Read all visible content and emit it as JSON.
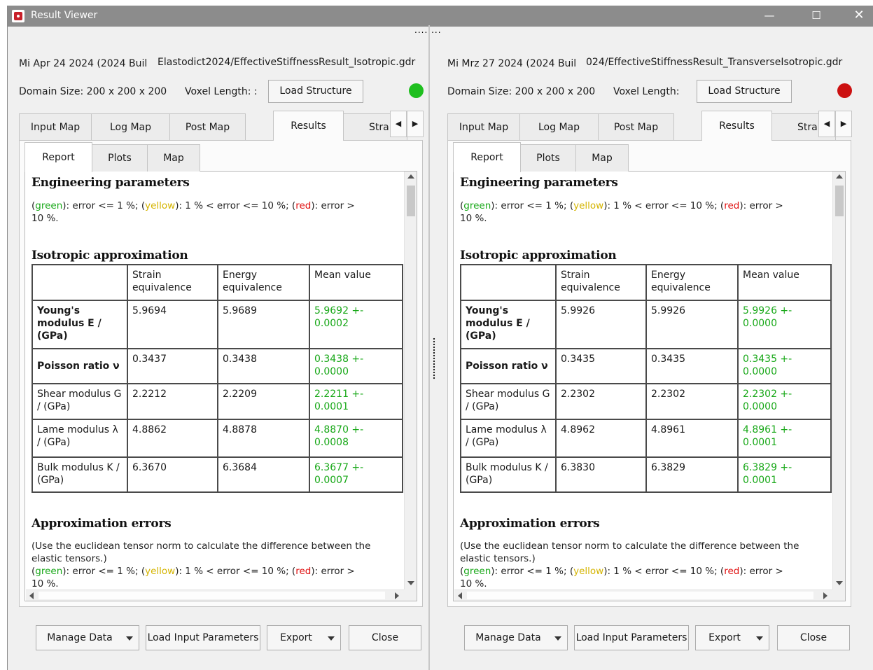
{
  "window": {
    "title": "Result Viewer",
    "min_glyph": "—",
    "max_glyph": "☐",
    "close_glyph": "✕",
    "splitter_dots": "........"
  },
  "panels": [
    {
      "date": "Mi Apr 24 2024 (2024 Buil",
      "path": "Elastodict2024/EffectiveStiffnessResult_Isotropic.gdr",
      "domain_size": "Domain Size: 200 x 200 x 200",
      "voxel_length": "Voxel Length: :",
      "load_structure": "Load Structure",
      "status_color": "#1fbf1f",
      "tabs": [
        "Input Map",
        "Log Map",
        "Post Map",
        "Results",
        "Stra"
      ],
      "subtabs": [
        "Report",
        "Plots",
        "Map"
      ],
      "report": {
        "heading1": "Engineering parameters",
        "legend": {
          "p1": "(",
          "green": "green",
          "p2": "): error <= 1 %; (",
          "yellow": "yellow",
          "p3": "): 1 % < error <= 10 %; (",
          "red": "red",
          "p4": "): error >",
          "p5": "10 %."
        },
        "heading2": "Isotropic approximation",
        "columns": [
          "",
          "Strain equivalence",
          "Energy equivalence",
          "Mean value"
        ],
        "rows": [
          {
            "label": "Young's modulus E / (GPa)",
            "bold": true,
            "strain": "5.9694",
            "energy": "5.9689",
            "mean": "5.9692 +- 0.0002"
          },
          {
            "label": "Poisson ratio ν",
            "bold": true,
            "strain": "0.3437",
            "energy": "0.3438",
            "mean": "0.3438 +- 0.0000"
          },
          {
            "label": "Shear modulus G / (GPa)",
            "bold": false,
            "strain": "2.2212",
            "energy": "2.2209",
            "mean": "2.2211 +- 0.0001"
          },
          {
            "label": "Lame modulus λ / (GPa)",
            "bold": false,
            "strain": "4.8862",
            "energy": "4.8878",
            "mean": "4.8870 +- 0.0008"
          },
          {
            "label": "Bulk modulus K / (GPa)",
            "bold": false,
            "strain": "6.3670",
            "energy": "6.3684",
            "mean": "6.3677 +- 0.0007"
          }
        ],
        "heading3": "Approximation errors",
        "errors_text": "(Use the euclidean tensor norm to calculate the difference between the elastic tensors.)",
        "legend2_tail": "10 %."
      },
      "buttons": {
        "manage": "Manage Data",
        "load_params": "Load Input Parameters",
        "export": "Export",
        "close": "Close"
      }
    },
    {
      "date": "Mi Mrz 27 2024 (2024 Buil",
      "path": "024/EffectiveStiffnessResult_TransverseIsotropic.gdr",
      "domain_size": "Domain Size: 200 x 200 x 200",
      "voxel_length": "Voxel Length:",
      "load_structure": "Load Structure",
      "status_color": "#cc1111",
      "tabs": [
        "Input Map",
        "Log Map",
        "Post Map",
        "Results",
        "Stra"
      ],
      "subtabs": [
        "Report",
        "Plots",
        "Map"
      ],
      "report": {
        "heading1": "Engineering parameters",
        "legend": {
          "p1": "(",
          "green": "green",
          "p2": "): error <= 1 %; (",
          "yellow": "yellow",
          "p3": "): 1 % < error <= 10 %; (",
          "red": "red",
          "p4": "): error >",
          "p5": "10 %."
        },
        "heading2": "Isotropic approximation",
        "columns": [
          "",
          "Strain equivalence",
          "Energy equivalence",
          "Mean value"
        ],
        "rows": [
          {
            "label": "Young's modulus E / (GPa)",
            "bold": true,
            "strain": "5.9926",
            "energy": "5.9926",
            "mean": "5.9926 +- 0.0000"
          },
          {
            "label": "Poisson ratio ν",
            "bold": true,
            "strain": "0.3435",
            "energy": "0.3435",
            "mean": "0.3435 +- 0.0000"
          },
          {
            "label": "Shear modulus G / (GPa)",
            "bold": false,
            "strain": "2.2302",
            "energy": "2.2302",
            "mean": "2.2302 +- 0.0000"
          },
          {
            "label": "Lame modulus λ / (GPa)",
            "bold": false,
            "strain": "4.8962",
            "energy": "4.8961",
            "mean": "4.8961 +- 0.0001"
          },
          {
            "label": "Bulk modulus K / (GPa)",
            "bold": false,
            "strain": "6.3830",
            "energy": "6.3829",
            "mean": "6.3829 +- 0.0001"
          }
        ],
        "heading3": "Approximation errors",
        "errors_text": "(Use the euclidean tensor norm to calculate the difference between the elastic tensors.)",
        "legend2_tail": "10 %."
      },
      "buttons": {
        "manage": "Manage Data",
        "load_params": "Load Input Parameters",
        "export": "Export",
        "close": "Close"
      }
    }
  ]
}
